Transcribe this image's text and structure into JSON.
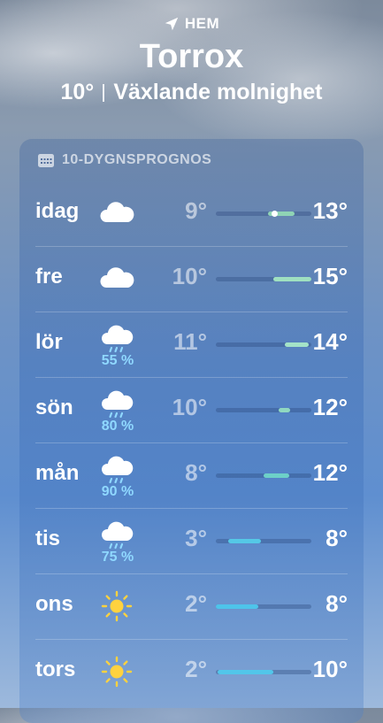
{
  "header": {
    "location_label": "HEM",
    "city": "Torrox",
    "current_temp": "10°",
    "condition": "Växlande molnighet"
  },
  "forecast": {
    "title": "10-DYGNSPROGNOS",
    "days": [
      {
        "day": "idag",
        "icon": "cloud-icon",
        "precip": "",
        "low": "9°",
        "high": "13°",
        "bar": {
          "from": 0.55,
          "to": 0.82,
          "color": "#8fd3b5"
        },
        "current": 0.62
      },
      {
        "day": "fre",
        "icon": "cloud-icon",
        "precip": "",
        "low": "10°",
        "high": "15°",
        "bar": {
          "from": 0.6,
          "to": 1.0,
          "color": "#9fe0c0"
        }
      },
      {
        "day": "lör",
        "icon": "cloud-rain-icon",
        "precip": "55 %",
        "low": "11°",
        "high": "14°",
        "bar": {
          "from": 0.72,
          "to": 0.97,
          "color": "#a4e3c8"
        }
      },
      {
        "day": "sön",
        "icon": "cloud-rain-icon",
        "precip": "80 %",
        "low": "10°",
        "high": "12°",
        "bar": {
          "from": 0.66,
          "to": 0.78,
          "color": "#90d8c0"
        }
      },
      {
        "day": "mån",
        "icon": "cloud-rain-icon",
        "precip": "90 %",
        "low": "8°",
        "high": "12°",
        "bar": {
          "from": 0.5,
          "to": 0.77,
          "color": "#6dd0c8"
        }
      },
      {
        "day": "tis",
        "icon": "cloud-rain-icon",
        "precip": "75 %",
        "low": "3°",
        "high": "8°",
        "bar": {
          "from": 0.13,
          "to": 0.47,
          "color": "#55c8e6"
        }
      },
      {
        "day": "ons",
        "icon": "sun-icon",
        "precip": "",
        "low": "2°",
        "high": "8°",
        "bar": {
          "from": 0.0,
          "to": 0.44,
          "color": "#4ec4ea"
        }
      },
      {
        "day": "tors",
        "icon": "sun-icon",
        "precip": "",
        "low": "2°",
        "high": "10°",
        "bar": {
          "from": 0.02,
          "to": 0.6,
          "color": "#52c6ea"
        }
      }
    ]
  }
}
